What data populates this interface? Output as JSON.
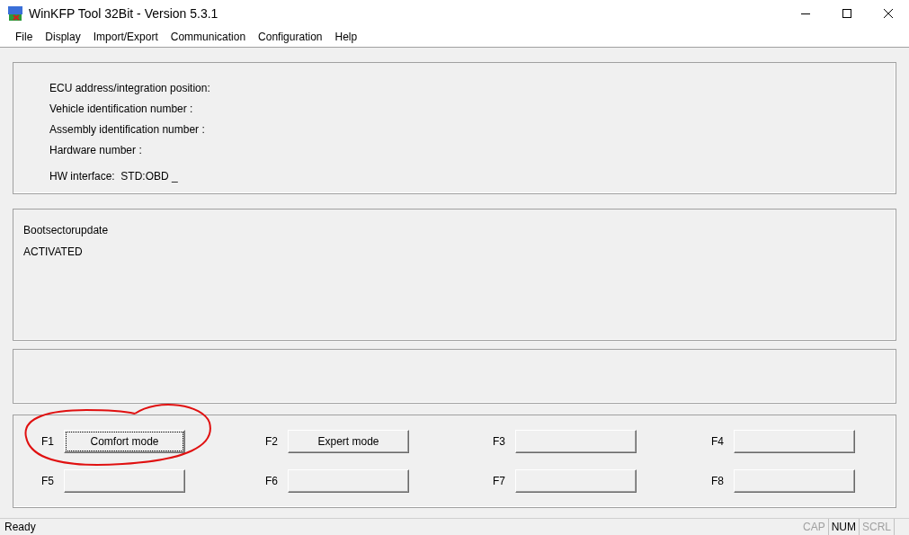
{
  "window": {
    "title": "WinKFP Tool 32Bit - Version 5.3.1"
  },
  "menu": [
    "File",
    "Display",
    "Import/Export",
    "Communication",
    "Configuration",
    "Help"
  ],
  "info_panel": {
    "lines": [
      "ECU address/integration position:",
      "Vehicle identification number :",
      "Assembly identification number :",
      "Hardware number :"
    ],
    "interface": "HW interface:  STD:OBD _"
  },
  "message_panel": {
    "lines": [
      "Bootsectorupdate",
      "ACTIVATED"
    ]
  },
  "function_keys": [
    {
      "key": "F1",
      "label": "Comfort mode",
      "focused": true
    },
    {
      "key": "F2",
      "label": "Expert mode",
      "focused": false
    },
    {
      "key": "F3",
      "focused": false
    },
    {
      "key": "F4",
      "focused": false
    },
    {
      "key": "F5",
      "focused": false
    },
    {
      "key": "F6",
      "focused": false
    },
    {
      "key": "F7",
      "focused": false
    },
    {
      "key": "F8",
      "focused": false
    }
  ],
  "status_bar": {
    "text": "Ready",
    "indicators": [
      {
        "label": "CAP",
        "on": false
      },
      {
        "label": "NUM",
        "on": true
      },
      {
        "label": "SCRL",
        "on": false
      }
    ]
  }
}
